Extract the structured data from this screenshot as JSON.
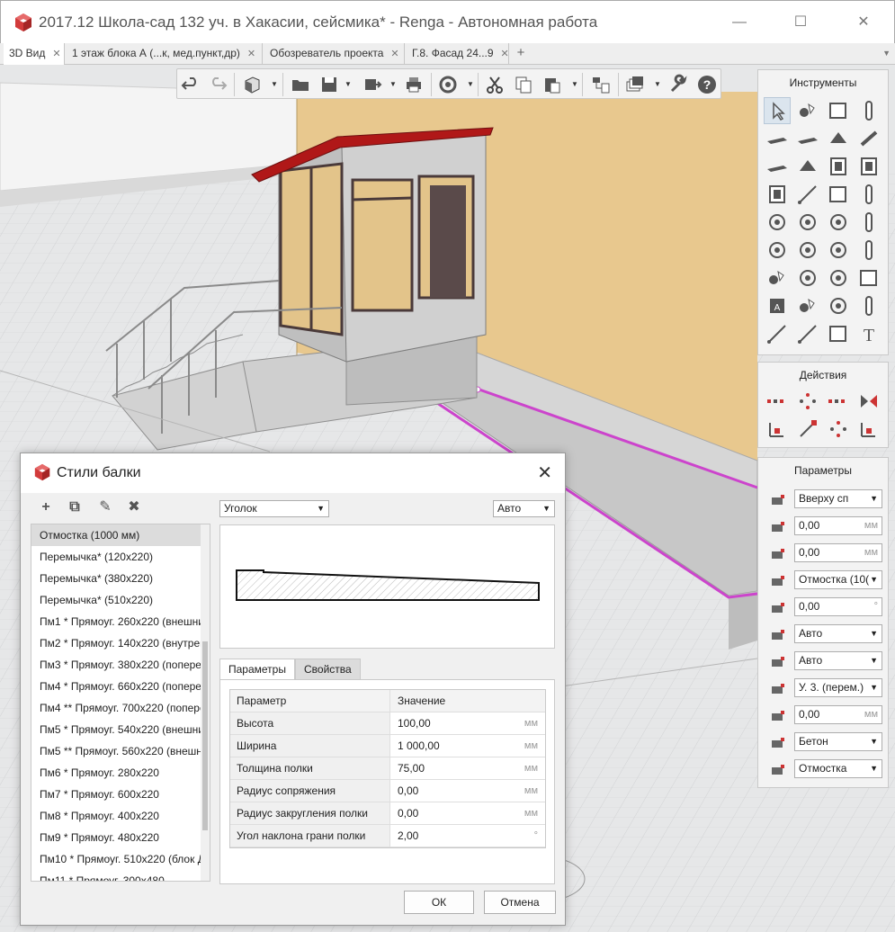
{
  "window": {
    "title": "2017.12 Школа-сад 132 уч. в Хакасии, сейсмика* - Renga - Автономная работа",
    "minimize": "—",
    "maximize": "☐",
    "close": "✕"
  },
  "tabs": [
    {
      "label": "3D Вид",
      "close": "✕"
    },
    {
      "label": "1 этаж блока А (...к, мед.пункт,др)",
      "close": "✕"
    },
    {
      "label": "Обозреватель проекта",
      "close": "✕"
    },
    {
      "label": "Г.8. Фасад 24...9",
      "close": "✕"
    }
  ],
  "tab_add": "+",
  "tab_dropdown": "▼",
  "toolbar": {
    "buttons": [
      "undo-icon",
      "redo-icon",
      "view-cube-icon",
      "open-folder-icon",
      "save-icon",
      "export-icon",
      "print-icon",
      "sync-icon",
      "cut-icon",
      "copy-icon",
      "paste-icon",
      "structure-icon",
      "layers-icon",
      "wrench-icon",
      "help-icon"
    ]
  },
  "panels": {
    "tools_title": "Инструменты",
    "actions_title": "Действия",
    "params_title": "Параметры"
  },
  "params": [
    {
      "icon": "placement-icon",
      "value": "Вверху сп",
      "type": "select"
    },
    {
      "icon": "offset-x-icon",
      "value": "0,00",
      "unit": "мм",
      "type": "input"
    },
    {
      "icon": "offset-y-icon",
      "value": "0,00",
      "unit": "мм",
      "type": "input"
    },
    {
      "icon": "beam-style-icon",
      "value": "Отмостка (10(",
      "type": "select"
    },
    {
      "icon": "rotation-icon",
      "value": "0,00",
      "unit": "°",
      "type": "input"
    },
    {
      "icon": "start-cut-icon",
      "value": "Авто",
      "type": "select"
    },
    {
      "icon": "end-cut-icon",
      "value": "Авто",
      "type": "select"
    },
    {
      "icon": "level-icon",
      "value": "У. 3. (перем.)",
      "type": "select"
    },
    {
      "icon": "elevation-icon",
      "value": "0,00",
      "unit": "мм",
      "type": "input"
    },
    {
      "icon": "material-icon",
      "value": "Бетон",
      "type": "select"
    },
    {
      "icon": "mark-icon",
      "value": "Отмостка",
      "type": "select"
    }
  ],
  "dialog": {
    "title": "Стили балки",
    "close": "✕",
    "toolbar": {
      "add": "+",
      "duplicate": "⧉",
      "edit": "✎",
      "delete": "✖"
    },
    "styles": [
      "Отмостка (1000 мм)",
      "Перемычка* (120x220)",
      "Перемычка* (380x220)",
      "Перемычка* (510x220)",
      "Пм1 * Прямоуг. 260x220 (внешни",
      "Пм2 * Прямоуг. 140x220 (внутрен",
      "Пм3 * Прямоуг. 380x220 (попере",
      "Пм4 * Прямоуг. 660x220 (попере",
      "Пм4 ** Прямоуг. 700x220 (попере",
      "Пм5 * Прямоуг. 540x220 (внешни",
      "Пм5 ** Прямоуг. 560x220 (внешн",
      "Пм6 * Прямоуг. 280x220",
      "Пм7 * Прямоуг. 600x220",
      "Пм8 * Прямоуг. 400x220",
      "Пм9 * Прямоуг. 480x220",
      "Пм10 * Прямоуг. 510x220 (блок Д",
      "Пм11 * Прямоуг. 300x480"
    ],
    "selected_style": 0,
    "profile_select": "Уголок",
    "mode_select": "Авто",
    "tabs": [
      "Параметры",
      "Свойства"
    ],
    "table_headers": [
      "Параметр",
      "Значение"
    ],
    "parameters": [
      {
        "name": "Высота",
        "value": "100,00",
        "unit": "мм"
      },
      {
        "name": "Ширина",
        "value": "1 000,00",
        "unit": "мм"
      },
      {
        "name": "Толщина полки",
        "value": "75,00",
        "unit": "мм"
      },
      {
        "name": "Радиус сопряжения",
        "value": "0,00",
        "unit": "мм"
      },
      {
        "name": "Радиус закругления полки",
        "value": "0,00",
        "unit": "мм"
      },
      {
        "name": "Угол наклона грани полки",
        "value": "2,00",
        "unit": "°"
      }
    ],
    "ok": "ОК",
    "cancel": "Отмена"
  },
  "colors": {
    "accent_selection": "#cc44cc",
    "wall": "#e8c88e",
    "roof": "#b01818",
    "panel_bg": "#f3f3f3"
  }
}
